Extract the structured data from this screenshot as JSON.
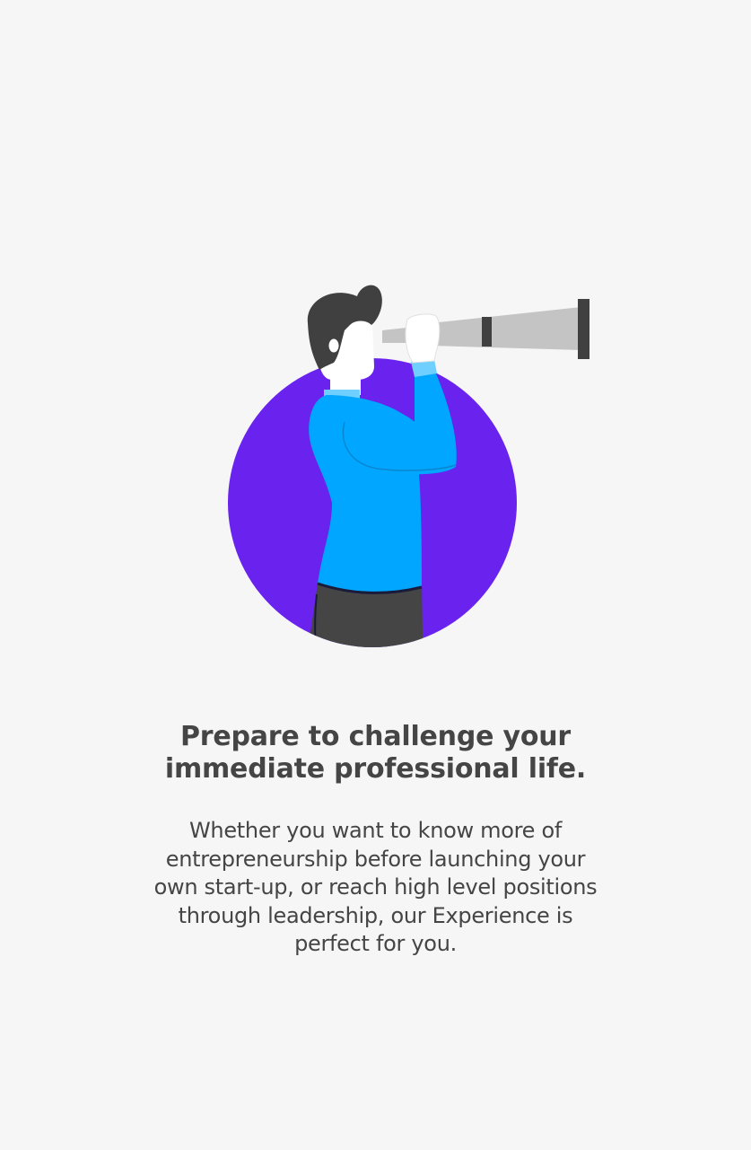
{
  "illustration": {
    "subject": "person-with-telescope",
    "colors": {
      "circle": "#6a22ee",
      "shirt": "#00a6ff",
      "collar": "#6fd0ff",
      "hair": "#404040",
      "pants": "#454545",
      "telescope": "#c4c4c4",
      "telescope_bands": "#404040",
      "skin": "#ffffff"
    }
  },
  "content": {
    "headline": "Prepare to challenge your immediate professional life.",
    "body": "Whether you want to know more of entrepreneurship before launching your own start-up, or reach high level positions through leadership, our Experience is perfect for you."
  },
  "theme": {
    "background": "#f6f6f7",
    "text": "#454545"
  }
}
